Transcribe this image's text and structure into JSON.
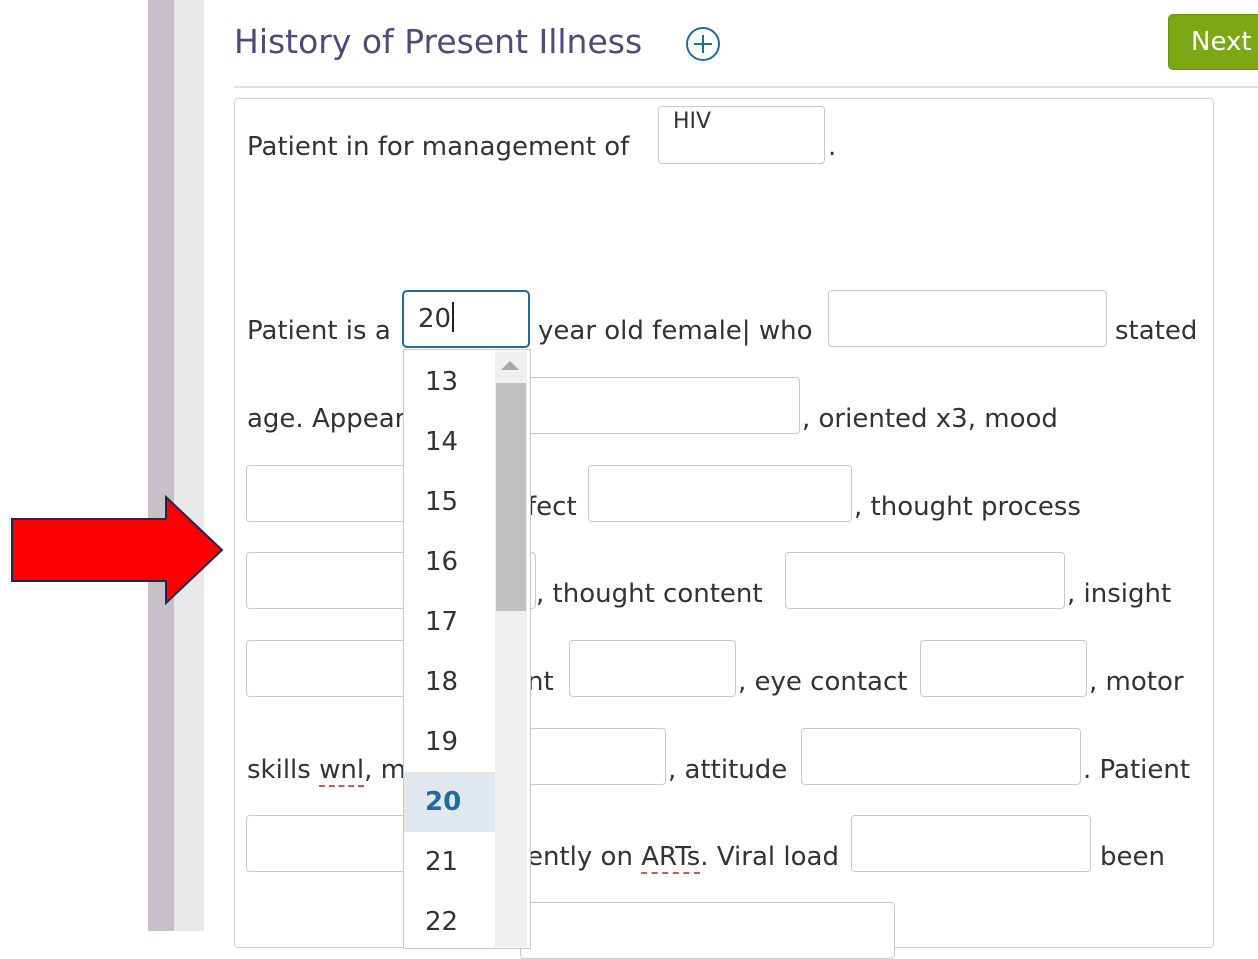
{
  "header": {
    "title": "History of Present Illness",
    "next_label": "Next"
  },
  "form": {
    "line1_prefix": "Patient in for management of",
    "line1_value": "HIV",
    "line1_suffix": ".",
    "line2_prefix": "Patient is a",
    "age_value": "20",
    "line2_mid": "year old female| who",
    "line2_suffix": "stated",
    "line3_prefix": "age. Appear",
    "line3_suffix": ", oriented x3, mood",
    "line4_a": "fect",
    "line4_b": ", thought process",
    "line5_a": ", thought content",
    "line5_b": ", insight",
    "line6_a": "nt",
    "line6_b": ", eye contact",
    "line6_c": ", motor",
    "line7_skills": "skills",
    "line7_wnl": "wnl",
    "line7_rest": ", m",
    "line7_b": ", attitude",
    "line7_c": ". Patient",
    "line8_a": "ently on",
    "line8_arts": "ARTs",
    "line8_b": ". Viral load",
    "line8_c": "been"
  },
  "age_dropdown": {
    "options": [
      "13",
      "14",
      "15",
      "16",
      "17",
      "18",
      "19",
      "20",
      "21",
      "22"
    ],
    "selected": "20"
  },
  "colors": {
    "accent": "#1f6c9d",
    "next_button": "#7da815",
    "title": "#4e4a79",
    "annotation_arrow": "#ff0000"
  }
}
